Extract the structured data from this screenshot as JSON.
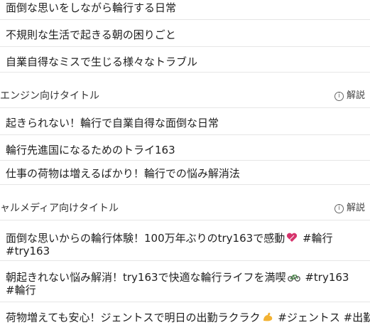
{
  "top_items": [
    "面倒な思いをしながら輪行する日常",
    "不規則な生活で起きる朝の困りごと",
    "自業自得なミスで生じる様々なトラブル"
  ],
  "seo_section": {
    "title": "エンジン向けタイトル",
    "explain_label": "解説",
    "items": [
      "起きられない！輪行で自業自得な面倒な日常",
      "輪行先進国になるためのトライ163",
      "仕事の荷物は増えるばかり！輪行での悩み解消法"
    ]
  },
  "social_section": {
    "title": "ャルメディア向けタイトル",
    "explain_label": "解説",
    "items": [
      {
        "line1": "面倒な思いからの輪行体験！100万年ぶりのtry163で感動",
        "emoji": "heart-icon",
        "tags_inline": "#輪行",
        "line2": "#try163"
      },
      {
        "line1": "朝起きれない悩み解消！try163で快適な輪行ライフを満喫",
        "emoji": "bicycle-icon",
        "tags_inline": "#try163",
        "line2": "#輪行"
      },
      {
        "line1": "荷物増えても安心！ジェントスで明日の出勤ラクラク",
        "emoji": "muscle-icon",
        "tags_inline": "#ジェントス #出勤"
      }
    ]
  },
  "colors": {
    "separator": "#e6e6e6",
    "heart": "#d6336c",
    "muscle": "#f2b233"
  }
}
